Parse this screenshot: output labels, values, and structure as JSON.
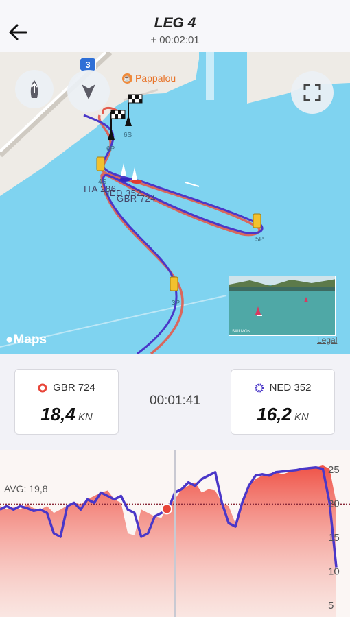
{
  "header": {
    "title": "LEG 4",
    "subtitle": "+ 00:02:01"
  },
  "map": {
    "poi_label": "Pappalou",
    "road_badge": "3",
    "marks": [
      "6P",
      "6S",
      "4S",
      "5P",
      "3P"
    ],
    "boat_labels": [
      "ITA 286",
      "NED 352",
      "GBR 724"
    ],
    "attribution": "Maps",
    "legal": "Legal",
    "video_overlay_text": "SAILMON"
  },
  "stats": {
    "left_boat": {
      "name": "GBR 724",
      "speed": "18,4",
      "unit": "KN",
      "color": "#e8463a"
    },
    "right_boat": {
      "name": "NED 352",
      "speed": "16,2",
      "unit": "KN",
      "color": "#4a37c8"
    },
    "elapsed": "00:01:41"
  },
  "chart_data": {
    "type": "area",
    "title": "",
    "avg_label": "AVG: 19,8",
    "avg": 19.8,
    "ylim": [
      4,
      27
    ],
    "yticks": [
      "25",
      "20",
      "15",
      "10",
      "5"
    ],
    "cursor_x": 0.5,
    "x": [
      0,
      2,
      4,
      6,
      8,
      10,
      12,
      14,
      16,
      18,
      20,
      22,
      24,
      26,
      28,
      30,
      32,
      34,
      36,
      38,
      40,
      42,
      44,
      46,
      48,
      50,
      52,
      54,
      56,
      58,
      60,
      62,
      64,
      66,
      68,
      70,
      72,
      74,
      76,
      78,
      80,
      82,
      84,
      86,
      88,
      90,
      92,
      94,
      96,
      98,
      100
    ],
    "series": [
      {
        "name": "GBR 724",
        "color": "#ef4a3e",
        "values": [
          19.5,
          19.0,
          19.3,
          19.0,
          19.8,
          19.2,
          19.0,
          19.5,
          18.5,
          19.0,
          19.6,
          20.0,
          19.8,
          20.5,
          21.0,
          21.5,
          21.8,
          20.5,
          20.0,
          15.5,
          15.2,
          19.0,
          18.5,
          18.0,
          17.8,
          19.5,
          20.5,
          22.0,
          22.5,
          23.0,
          21.5,
          22.0,
          21.8,
          20.0,
          19.5,
          17.0,
          20.5,
          22.5,
          23.5,
          24.0,
          24.3,
          24.5,
          24.2,
          24.5,
          24.8,
          25.0,
          25.3,
          25.2,
          25.5,
          25.0,
          20.0
        ]
      },
      {
        "name": "NED 352",
        "color": "#4a37c8",
        "values": [
          19.0,
          19.5,
          19.0,
          19.5,
          19.2,
          18.8,
          19.0,
          18.5,
          15.5,
          15.0,
          19.5,
          20.0,
          19.0,
          20.5,
          20.0,
          21.5,
          21.0,
          20.5,
          21.0,
          19.0,
          18.5,
          15.0,
          15.5,
          18.0,
          18.5,
          19.0,
          21.5,
          22.0,
          23.0,
          22.5,
          23.5,
          24.0,
          24.5,
          20.0,
          17.0,
          16.5,
          20.0,
          22.5,
          24.0,
          24.2,
          24.0,
          24.5,
          24.6,
          24.7,
          24.8,
          25.0,
          25.1,
          25.2,
          25.0,
          20.0,
          10.5
        ]
      }
    ]
  }
}
